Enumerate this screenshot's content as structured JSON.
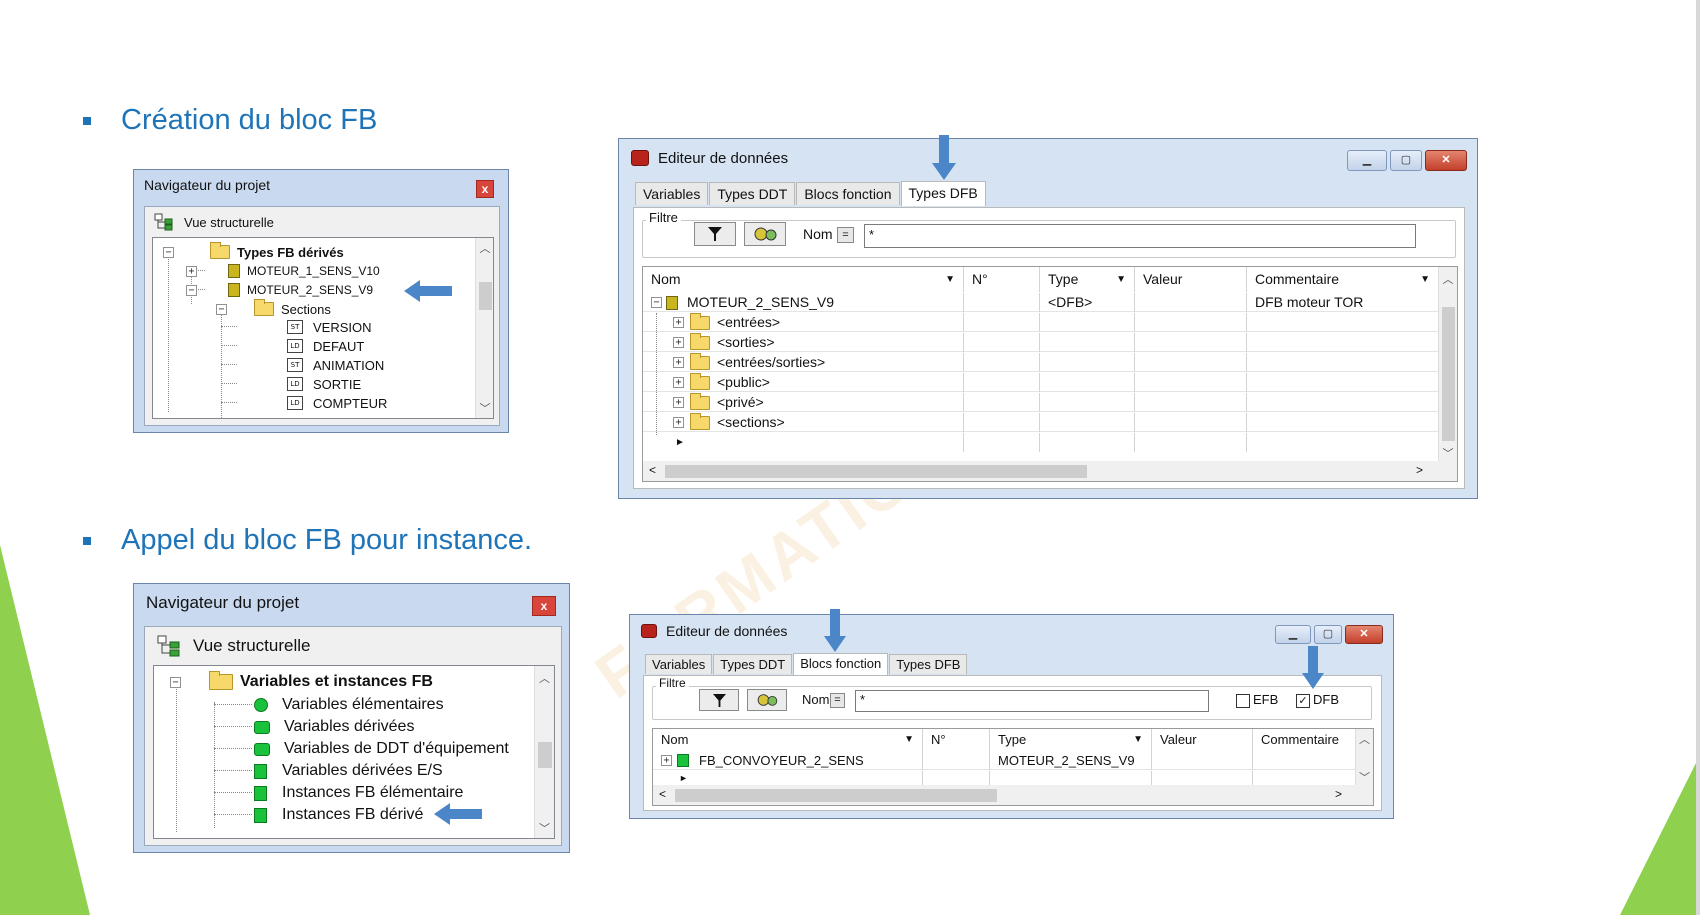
{
  "sections": [
    {
      "heading": "Création du bloc FB"
    },
    {
      "heading": "Appel du bloc FB pour instance."
    }
  ],
  "watermark": "FORMATIO",
  "nav1": {
    "title": "Navigateur du projet",
    "close": "x",
    "view_label": "Vue structurelle",
    "root": "Types FB dérivés",
    "items": [
      "MOTEUR_1_SENS_V10",
      "MOTEUR_2_SENS_V9"
    ],
    "sections_label": "Sections",
    "sections": [
      {
        "lang": "ST",
        "name": "VERSION"
      },
      {
        "lang": "LD",
        "name": "DEFAUT"
      },
      {
        "lang": "ST",
        "name": "ANIMATION"
      },
      {
        "lang": "LD",
        "name": "SORTIE"
      },
      {
        "lang": "LD",
        "name": "COMPTEUR"
      }
    ]
  },
  "editor1": {
    "title": "Editeur de données",
    "tabs": [
      "Variables",
      "Types DDT",
      "Blocs fonction",
      "Types DFB"
    ],
    "active_tab": "Types DFB",
    "filter_label": "Filtre",
    "nom_label": "Nom",
    "eq": "=",
    "filter_value": "*",
    "columns": [
      "Nom",
      "N°",
      "Type",
      "Valeur",
      "Commentaire"
    ],
    "row": {
      "name": "MOTEUR_2_SENS_V9",
      "type": "<DFB>",
      "comment": "DFB moteur TOR"
    },
    "children": [
      "<entrées>",
      "<sorties>",
      "<entrées/sorties>",
      "<public>",
      "<privé>",
      "<sections>"
    ]
  },
  "nav2": {
    "title": "Navigateur du projet",
    "close": "x",
    "view_label": "Vue structurelle",
    "root": "Variables et instances FB",
    "items": [
      "Variables élémentaires",
      "Variables dérivées",
      "Variables de DDT d'équipement",
      "Variables dérivées E/S",
      "Instances FB élémentaire",
      "Instances FB dérivé"
    ]
  },
  "editor2": {
    "title": "Editeur de données",
    "tabs": [
      "Variables",
      "Types DDT",
      "Blocs fonction",
      "Types DFB"
    ],
    "active_tab": "Blocs fonction",
    "filter_label": "Filtre",
    "nom_label": "Nom",
    "eq": "=",
    "filter_value": "*",
    "efb_label": "EFB",
    "dfb_label": "DFB",
    "efb_checked": false,
    "dfb_checked": true,
    "columns": [
      "Nom",
      "N°",
      "Type",
      "Valeur",
      "Commentaire"
    ],
    "row": {
      "name": "FB_CONVOYEUR_2_SENS",
      "type": "MOTEUR_2_SENS_V9"
    }
  },
  "colors": {
    "accent": "#1f74b8",
    "arrow": "#4a86c8",
    "slide_green": "#8fd14f",
    "window_frame": "#c9daf0"
  }
}
